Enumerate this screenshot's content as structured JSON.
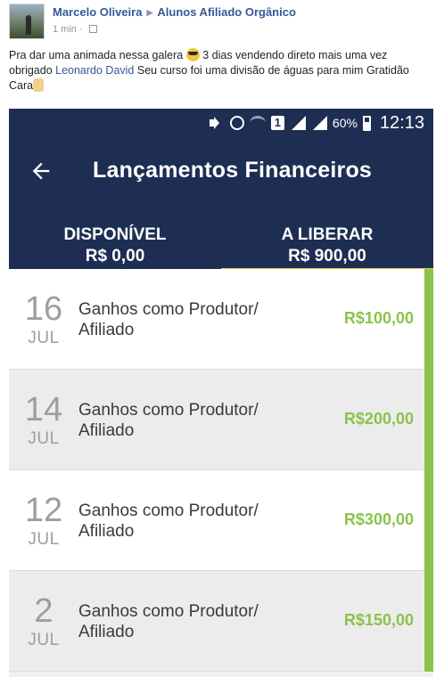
{
  "post": {
    "author": "Marcelo Oliveira",
    "group": "Alunos Afiliado Orgânico",
    "time": "1 min",
    "separator": "·",
    "text_part1": "Pra dar uma animada nessa galera ",
    "text_part2": " 3 dias vendendo direto mais uma vez obrigado ",
    "mention": "Leonardo David",
    "text_part3": " Seu curso foi uma divisão de águas para mim Gratidão Cara"
  },
  "phone": {
    "status": {
      "battery": "60%",
      "time": "12:13",
      "sim": "1"
    },
    "app_title": "Lançamentos Financeiros",
    "tabs": [
      {
        "label": "DISPONÍVEL",
        "value": "R$ 0,00"
      },
      {
        "label": "A LIBERAR",
        "value": "R$ 900,00"
      }
    ],
    "entries": [
      {
        "day": "16",
        "month": "JUL",
        "line1": "Ganhos como Produtor/",
        "line2": "Afiliado",
        "amount": "R$100,00"
      },
      {
        "day": "14",
        "month": "JUL",
        "line1": "Ganhos como Produtor/",
        "line2": "Afiliado",
        "amount": "R$200,00"
      },
      {
        "day": "12",
        "month": "JUL",
        "line1": "Ganhos como Produtor/",
        "line2": "Afiliado",
        "amount": "R$300,00"
      },
      {
        "day": "2",
        "month": "JUL",
        "line1": "Ganhos como Produtor/",
        "line2": "Afiliado",
        "amount": "R$150,00"
      }
    ]
  },
  "colors": {
    "appbar": "#1e2e52",
    "accent_green": "#8bc34a",
    "tab_indicator": "#f5c84c",
    "fb_link": "#365899"
  }
}
